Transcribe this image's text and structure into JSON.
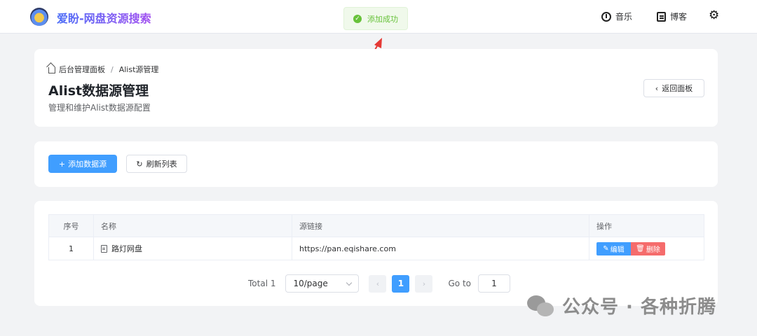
{
  "header": {
    "brand": "爱盼-网盘资源搜索",
    "nav": [
      {
        "label": "音乐",
        "icon": "music-icon"
      },
      {
        "label": "博客",
        "icon": "blog-icon"
      }
    ],
    "settings_icon": "gear-icon"
  },
  "toast": {
    "text": "添加成功",
    "icon": "success-check-icon",
    "color": "#67c23a"
  },
  "page_header": {
    "breadcrumb": [
      "后台管理面板",
      "Alist源管理"
    ],
    "breadcrumb_separator": "/",
    "title": "Alist数据源管理",
    "subtitle": "管理和维护Alist数据源配置",
    "back_label": "返回面板"
  },
  "toolbar": {
    "add_label": "添加数据源",
    "refresh_label": "刷新列表"
  },
  "table": {
    "columns": [
      "序号",
      "名称",
      "源链接",
      "操作"
    ],
    "rows": [
      {
        "index": "1",
        "name": "路灯网盘",
        "url": "https://pan.eqishare.com",
        "edit_label": "编辑",
        "delete_label": "删除"
      }
    ]
  },
  "pagination": {
    "total": "Total 1",
    "page_size": "10/page",
    "current_page": "1",
    "goto_label": "Go to",
    "goto_value": "1"
  },
  "watermark": {
    "text": "公众号 · 各种折腾"
  },
  "colors": {
    "primary": "#409eff",
    "danger": "#f56c6c",
    "success": "#67c23a",
    "annotation_arrow": "#e53935"
  }
}
